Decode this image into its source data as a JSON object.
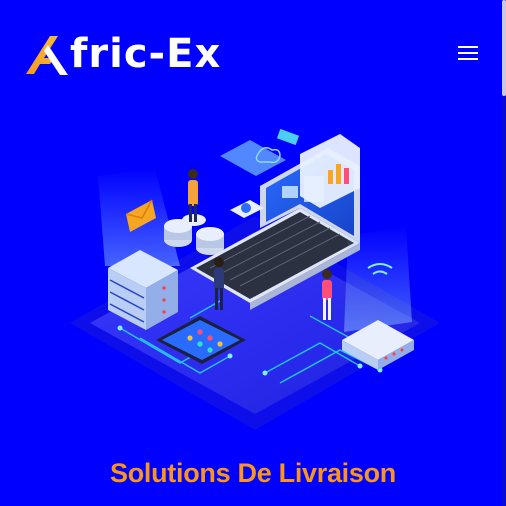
{
  "header": {
    "logo_text": "fric-Ex",
    "brand_accent": "#f7951d",
    "menu_icon": "hamburger-menu-icon"
  },
  "hero": {
    "title": "Solutions De Livraison",
    "illustration": "isometric-technology-illustration"
  },
  "colors": {
    "background": "#0000ff",
    "title": "#f7951d",
    "logo_text": "#ffffff"
  }
}
